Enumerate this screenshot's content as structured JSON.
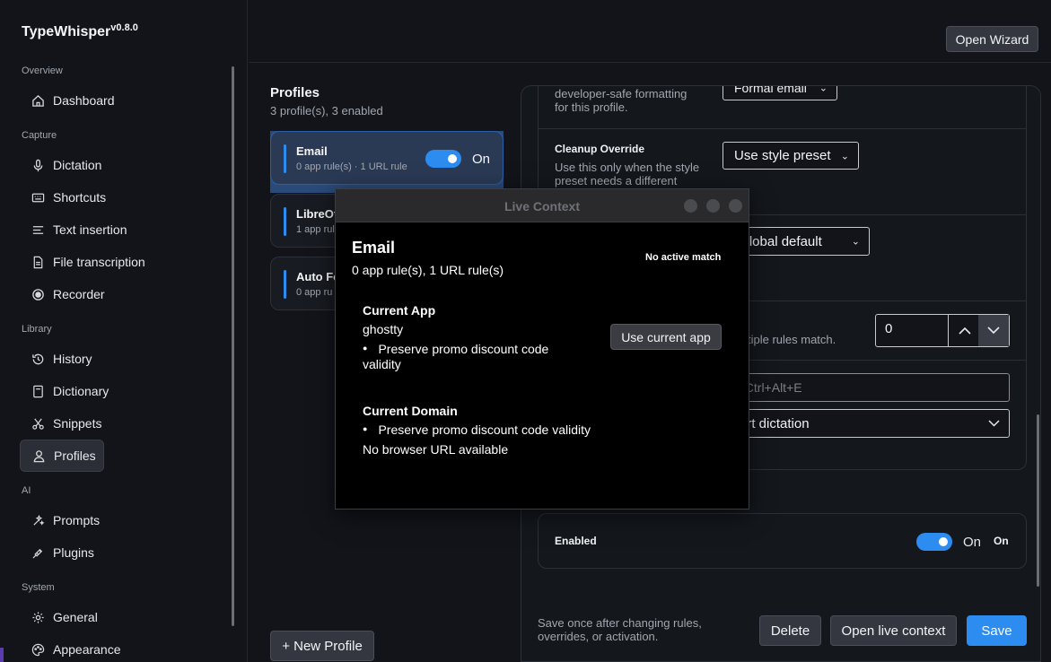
{
  "app": {
    "name": "TypeWhisper",
    "version": "v0.8.0"
  },
  "sidebar": {
    "sections": [
      {
        "title": "Overview"
      },
      {
        "title": "Capture"
      },
      {
        "title": "Library"
      },
      {
        "title": "AI"
      },
      {
        "title": "System"
      }
    ],
    "items": [
      {
        "label": "Dashboard",
        "icon": "home-icon"
      },
      {
        "label": "Dictation",
        "icon": "microphone-icon"
      },
      {
        "label": "Shortcuts",
        "icon": "keyboard-icon"
      },
      {
        "label": "Text insertion",
        "icon": "text-lines-icon"
      },
      {
        "label": "File transcription",
        "icon": "file-icon"
      },
      {
        "label": "Recorder",
        "icon": "record-icon"
      },
      {
        "label": "History",
        "icon": "history-icon"
      },
      {
        "label": "Dictionary",
        "icon": "book-icon"
      },
      {
        "label": "Snippets",
        "icon": "scissors-icon"
      },
      {
        "label": "Profiles",
        "icon": "user-icon",
        "active": true
      },
      {
        "label": "Prompts",
        "icon": "sparkle-icon"
      },
      {
        "label": "Plugins",
        "icon": "plug-icon"
      },
      {
        "label": "General",
        "icon": "gear-icon"
      },
      {
        "label": "Appearance",
        "icon": "palette-icon"
      }
    ]
  },
  "header": {
    "wizard_label": "Open Wizard"
  },
  "profiles": {
    "title": "Profiles",
    "subtitle": "3 profile(s), 3 enabled",
    "list": [
      {
        "name": "Email",
        "desc": "0 app rule(s)  ·  1 URL rule",
        "toggle_label": "On",
        "selected": true
      },
      {
        "name": "LibreOf",
        "desc": "1 app rul"
      },
      {
        "name": "Auto Fo",
        "desc": "0 app ru"
      }
    ],
    "new_label": "+ New Profile"
  },
  "detail": {
    "style_desc": [
      "developer-safe formatting",
      "for this profile."
    ],
    "style_value": "Formal email",
    "cleanup_label": "Cleanup Override",
    "cleanup_desc": [
      "Use this only when the style",
      "preset needs a different"
    ],
    "cleanup_value": "Use style preset",
    "third_value": "e global default",
    "priority_desc": "tiple rules match.",
    "priority_value": "0",
    "hotkey_placeholder": ". Ctrl+Alt+E",
    "action_value": "art dictation",
    "enabled_label": "Enabled",
    "enabled_toggle": "On",
    "enabled_state": "On",
    "footer_note": [
      "Save once after changing rules,",
      "overrides, or activation."
    ],
    "delete_label": "Delete",
    "live_context_label": "Open live context",
    "save_label": "Save"
  },
  "live_context": {
    "window_title": "Live Context",
    "profile_name": "Email",
    "rules_summary": "0 app rule(s), 1 URL rule(s)",
    "match_status": "No active match",
    "current_app_title": "Current App",
    "current_app_value": "ghostty",
    "app_bullet": "Preserve promo discount code",
    "app_bullet_cont": "validity",
    "use_app_label": "Use current app",
    "current_domain_title": "Current Domain",
    "domain_bullet": "Preserve promo discount code validity",
    "no_url": "No browser URL available"
  },
  "colors": {
    "accent": "#2d8cf0",
    "background": "#12141a",
    "selected_card": "#2a4a7a"
  }
}
